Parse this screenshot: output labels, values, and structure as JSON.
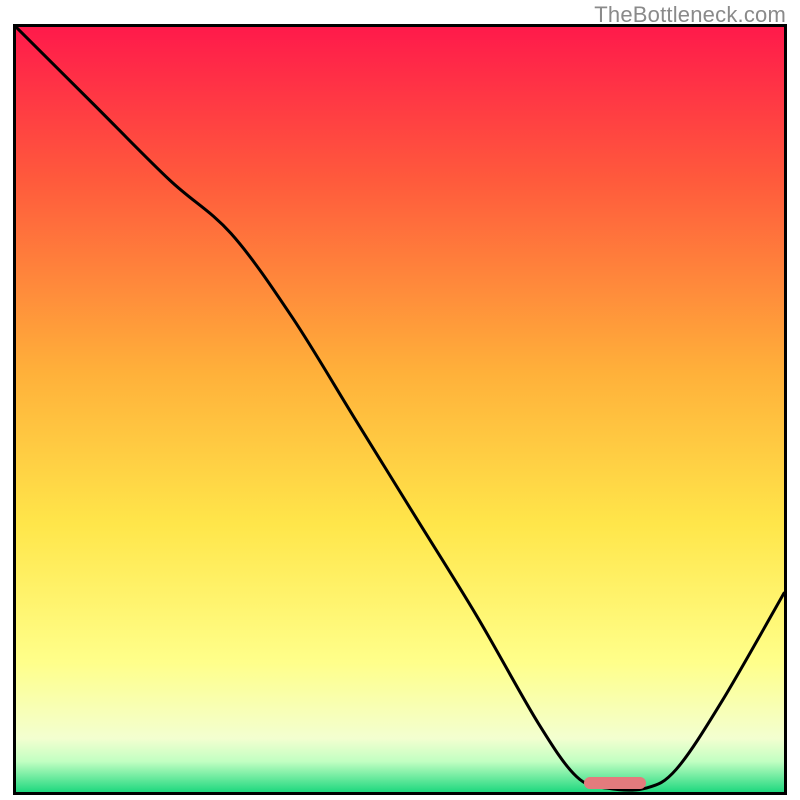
{
  "watermark": "TheBottleneck.com",
  "chart_data": {
    "type": "line",
    "title": "",
    "xlabel": "",
    "ylabel": "",
    "xlim": [
      0,
      100
    ],
    "ylim": [
      0,
      100
    ],
    "background_gradient": {
      "stops": [
        {
          "pos": 0.0,
          "color": "#ff1a4b"
        },
        {
          "pos": 0.2,
          "color": "#ff5a3c"
        },
        {
          "pos": 0.45,
          "color": "#ffb03a"
        },
        {
          "pos": 0.65,
          "color": "#ffe64a"
        },
        {
          "pos": 0.83,
          "color": "#ffff8a"
        },
        {
          "pos": 0.93,
          "color": "#f3ffd0"
        },
        {
          "pos": 0.96,
          "color": "#c2ffc2"
        },
        {
          "pos": 1.0,
          "color": "#1fd87f"
        }
      ]
    },
    "series": [
      {
        "name": "bottleneck-curve",
        "x": [
          0,
          10,
          20,
          28,
          36,
          44,
          52,
          60,
          68,
          73,
          77,
          82,
          86,
          92,
          100
        ],
        "y": [
          100,
          90,
          80,
          73,
          62,
          49,
          36,
          23,
          9,
          2,
          0.5,
          0.5,
          3,
          12,
          26
        ]
      }
    ],
    "marker": {
      "name": "optimal-range",
      "x_start": 74,
      "x_end": 82,
      "y": 1.2,
      "color": "#e37b7d"
    }
  }
}
